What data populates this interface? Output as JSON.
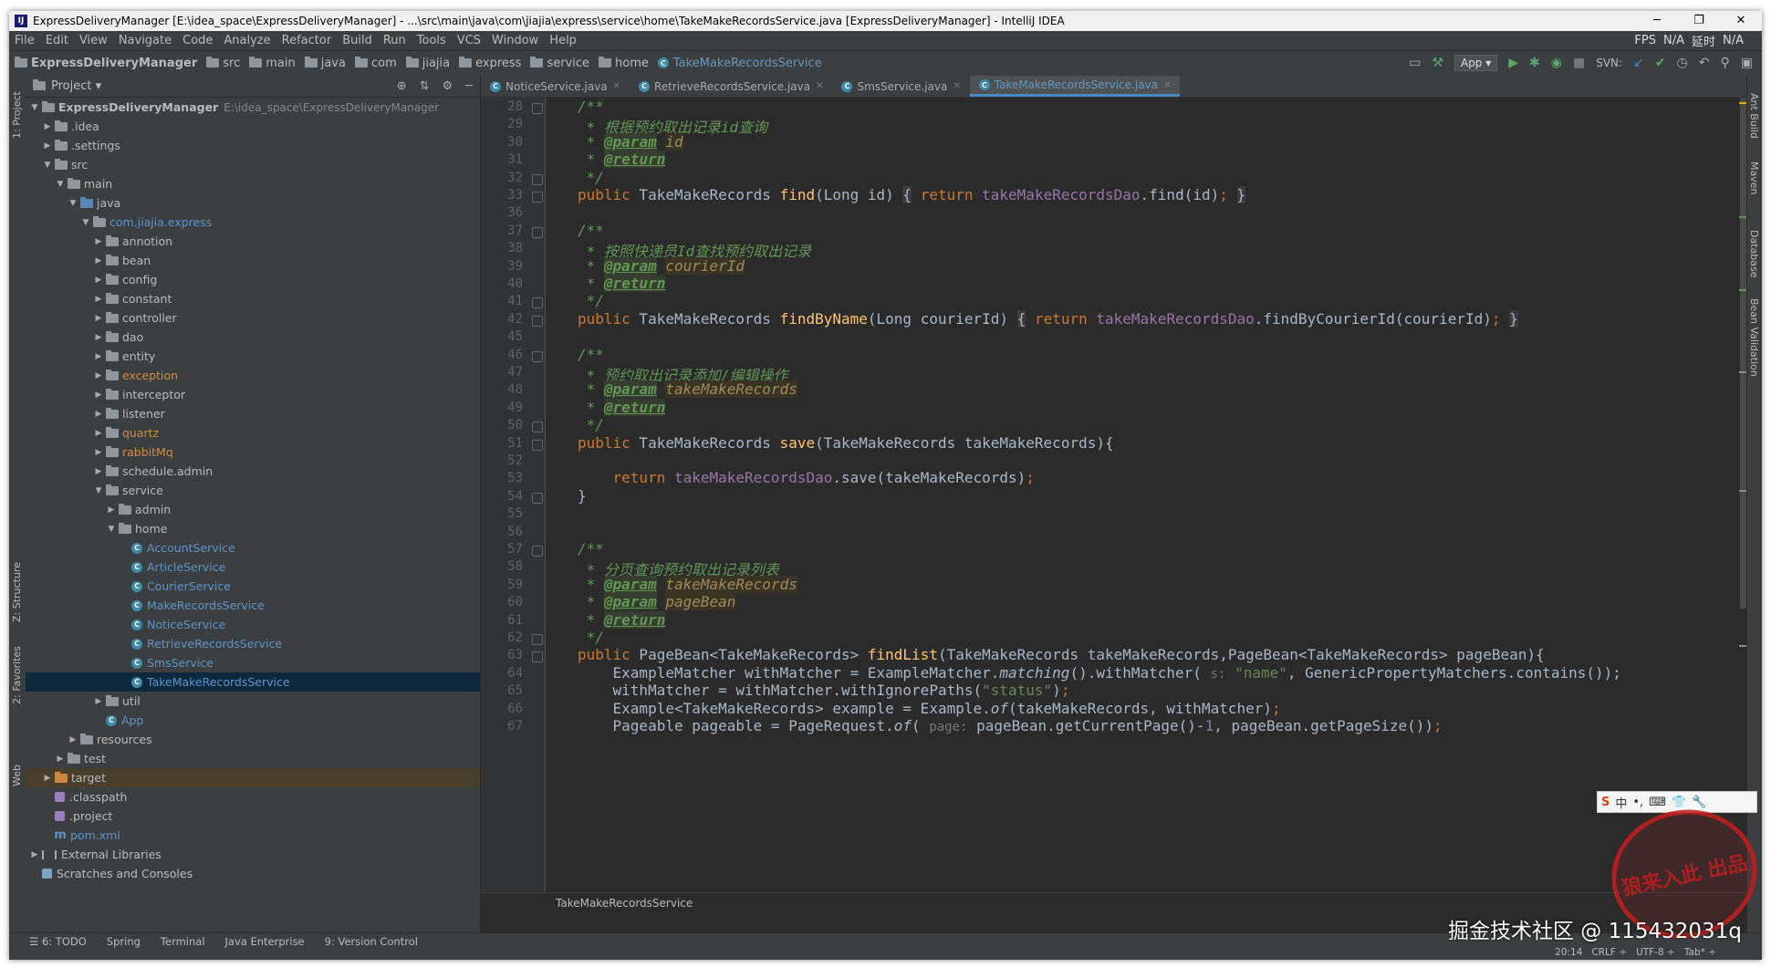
{
  "window": {
    "title": "ExpressDeliveryManager [E:\\idea_space\\ExpressDeliveryManager] - ...\\src\\main\\java\\com\\jiajia\\express\\service\\home\\TakeMakeRecordsService.java [ExpressDeliveryManager] - IntelliJ IDEA",
    "minimize": "─",
    "maximize": "❐",
    "close": "✕",
    "app_icon": "IJ"
  },
  "menu": {
    "items": [
      "File",
      "Edit",
      "View",
      "Navigate",
      "Code",
      "Analyze",
      "Refactor",
      "Build",
      "Run",
      "Tools",
      "VCS",
      "Window",
      "Help"
    ],
    "right": [
      "FPS",
      "N/A",
      "延时",
      "N/A"
    ]
  },
  "breadcrumb": [
    "ExpressDeliveryManager",
    "src",
    "main",
    "java",
    "com",
    "jiajia",
    "express",
    "service",
    "home",
    "TakeMakeRecordsService"
  ],
  "toolbar": {
    "run_config": "App ▾",
    "svn_label": "SVN:"
  },
  "left_strip": {
    "project": "1: Project",
    "structure": "Z: Structure",
    "favorites": "2: Favorites",
    "web": "Web"
  },
  "project_panel": {
    "title": "Project ▾"
  },
  "tree": [
    {
      "label": "ExpressDeliveryManager",
      "detail": "E:\\idea_space\\ExpressDeliveryManager",
      "depth": 0,
      "arrow": "▼",
      "kind": "folder",
      "bold": true
    },
    {
      "label": ".idea",
      "depth": 1,
      "arrow": "▶",
      "kind": "folder"
    },
    {
      "label": ".settings",
      "depth": 1,
      "arrow": "▶",
      "kind": "folder"
    },
    {
      "label": "src",
      "depth": 1,
      "arrow": "▼",
      "kind": "folder"
    },
    {
      "label": "main",
      "depth": 2,
      "arrow": "▼",
      "kind": "folder"
    },
    {
      "label": "java",
      "depth": 3,
      "arrow": "▼",
      "kind": "folder-blue"
    },
    {
      "label": "com.jiajia.express",
      "depth": 4,
      "arrow": "▼",
      "kind": "folder",
      "color": "blue"
    },
    {
      "label": "annotion",
      "depth": 5,
      "arrow": "▶",
      "kind": "folder"
    },
    {
      "label": "bean",
      "depth": 5,
      "arrow": "▶",
      "kind": "folder"
    },
    {
      "label": "config",
      "depth": 5,
      "arrow": "▶",
      "kind": "folder"
    },
    {
      "label": "constant",
      "depth": 5,
      "arrow": "▶",
      "kind": "folder"
    },
    {
      "label": "controller",
      "depth": 5,
      "arrow": "▶",
      "kind": "folder"
    },
    {
      "label": "dao",
      "depth": 5,
      "arrow": "▶",
      "kind": "folder"
    },
    {
      "label": "entity",
      "depth": 5,
      "arrow": "▶",
      "kind": "folder"
    },
    {
      "label": "exception",
      "depth": 5,
      "arrow": "▶",
      "kind": "folder",
      "color": "orange"
    },
    {
      "label": "interceptor",
      "depth": 5,
      "arrow": "▶",
      "kind": "folder"
    },
    {
      "label": "listener",
      "depth": 5,
      "arrow": "▶",
      "kind": "folder"
    },
    {
      "label": "quartz",
      "depth": 5,
      "arrow": "▶",
      "kind": "folder",
      "color": "orange"
    },
    {
      "label": "rabbitMq",
      "depth": 5,
      "arrow": "▶",
      "kind": "folder",
      "color": "orange"
    },
    {
      "label": "schedule.admin",
      "depth": 5,
      "arrow": "▶",
      "kind": "folder"
    },
    {
      "label": "service",
      "depth": 5,
      "arrow": "▼",
      "kind": "folder"
    },
    {
      "label": "admin",
      "depth": 6,
      "arrow": "▶",
      "kind": "folder"
    },
    {
      "label": "home",
      "depth": 6,
      "arrow": "▼",
      "kind": "folder"
    },
    {
      "label": "AccountService",
      "depth": 7,
      "arrow": "",
      "kind": "class",
      "color": "blue"
    },
    {
      "label": "ArticleService",
      "depth": 7,
      "arrow": "",
      "kind": "class",
      "color": "blue"
    },
    {
      "label": "CourierService",
      "depth": 7,
      "arrow": "",
      "kind": "class",
      "color": "blue"
    },
    {
      "label": "MakeRecordsService",
      "depth": 7,
      "arrow": "",
      "kind": "class",
      "color": "blue"
    },
    {
      "label": "NoticeService",
      "depth": 7,
      "arrow": "",
      "kind": "class",
      "color": "blue"
    },
    {
      "label": "RetrieveRecordsService",
      "depth": 7,
      "arrow": "",
      "kind": "class",
      "color": "blue"
    },
    {
      "label": "SmsService",
      "depth": 7,
      "arrow": "",
      "kind": "class",
      "color": "blue"
    },
    {
      "label": "TakeMakeRecordsService",
      "depth": 7,
      "arrow": "",
      "kind": "class",
      "color": "blue",
      "selected": true
    },
    {
      "label": "util",
      "depth": 5,
      "arrow": "▶",
      "kind": "folder"
    },
    {
      "label": "App",
      "depth": 5,
      "arrow": "",
      "kind": "class",
      "color": "blue"
    },
    {
      "label": "resources",
      "depth": 3,
      "arrow": "▶",
      "kind": "folder"
    },
    {
      "label": "test",
      "depth": 2,
      "arrow": "▶",
      "kind": "folder"
    },
    {
      "label": "target",
      "depth": 1,
      "arrow": "▶",
      "kind": "folder-orange",
      "highlight": true
    },
    {
      "label": ".classpath",
      "depth": 1,
      "arrow": "",
      "kind": "file"
    },
    {
      "label": ".project",
      "depth": 1,
      "arrow": "",
      "kind": "file"
    },
    {
      "label": "pom.xml",
      "depth": 1,
      "arrow": "",
      "kind": "maven",
      "color": "blue"
    },
    {
      "label": "External Libraries",
      "depth": 0,
      "arrow": "▶",
      "kind": "lib"
    },
    {
      "label": "Scratches and Consoles",
      "depth": 0,
      "arrow": "",
      "kind": "scratch"
    }
  ],
  "editor_tabs": [
    {
      "label": "NoticeService.java",
      "active": false
    },
    {
      "label": "RetrieveRecordsService.java",
      "active": false
    },
    {
      "label": "SmsService.java",
      "active": false
    },
    {
      "label": "TakeMakeRecordsService.java",
      "active": true
    }
  ],
  "code_lines": [
    {
      "n": "28",
      "html": "<span class=\"cm\">/**</span>"
    },
    {
      "n": "29",
      "html": "<span class=\"cm\"> * 根据预约取出记录id查询</span>"
    },
    {
      "n": "30",
      "html": "<span class=\"cm\"> * </span><span class=\"tag\">@param</span><span class=\"cm\"> </span><span class=\"pv\">id</span>"
    },
    {
      "n": "31",
      "html": "<span class=\"cm\"> * </span><span class=\"tag\">@return</span>"
    },
    {
      "n": "32",
      "html": "<span class=\"cm\"> */</span>"
    },
    {
      "n": "33",
      "html": "<span class=\"kw\">public</span> TakeMakeRecords <span class=\"fn\">find</span>(Long id) <span class=\"fold-brace\">{</span> <span class=\"kw\">return</span> <span class=\"fld\">takeMakeRecordsDao</span>.find(id)<span class=\"kw\">;</span> <span class=\"fold-brace\">}</span>"
    },
    {
      "n": "36",
      "html": ""
    },
    {
      "n": "37",
      "html": "<span class=\"cm\">/**</span>"
    },
    {
      "n": "38",
      "html": "<span class=\"cm\"> * 按照快递员Id查找预约取出记录</span>"
    },
    {
      "n": "39",
      "html": "<span class=\"cm\"> * </span><span class=\"tag\">@param</span><span class=\"cm\"> </span><span class=\"pv\">courierId</span>"
    },
    {
      "n": "40",
      "html": "<span class=\"cm\"> * </span><span class=\"tag\">@return</span>"
    },
    {
      "n": "41",
      "html": "<span class=\"cm\"> */</span>"
    },
    {
      "n": "42",
      "html": "<span class=\"kw\">public</span> TakeMakeRecords <span class=\"fn\">findByName</span>(Long courierId) <span class=\"fold-brace\">{</span> <span class=\"kw\">return</span> <span class=\"fld\">takeMakeRecordsDao</span>.findByCourierId(courierId)<span class=\"kw\">;</span> <span class=\"fold-brace\">}</span>"
    },
    {
      "n": "45",
      "html": ""
    },
    {
      "n": "46",
      "html": "<span class=\"cm\">/**</span>"
    },
    {
      "n": "47",
      "html": "<span class=\"cm\"> * 预约取出记录添加/编辑操作</span>"
    },
    {
      "n": "48",
      "html": "<span class=\"cm\"> * </span><span class=\"tag\">@param</span><span class=\"cm\"> </span><span class=\"pv\">takeMakeRecords</span>"
    },
    {
      "n": "49",
      "html": "<span class=\"cm\"> * </span><span class=\"tag\">@return</span>"
    },
    {
      "n": "50",
      "html": "<span class=\"cm\"> */</span>"
    },
    {
      "n": "51",
      "html": "<span class=\"kw\">public</span> TakeMakeRecords <span class=\"fn\">save</span>(TakeMakeRecords takeMakeRecords){"
    },
    {
      "n": "52",
      "html": ""
    },
    {
      "n": "53",
      "html": "    <span class=\"kw\">return</span> <span class=\"fld\">takeMakeRecordsDao</span>.save(takeMakeRecords)<span class=\"kw\">;</span>"
    },
    {
      "n": "54",
      "html": "}"
    },
    {
      "n": "55",
      "html": ""
    },
    {
      "n": "56",
      "html": ""
    },
    {
      "n": "57",
      "html": "<span class=\"cm\">/**</span>"
    },
    {
      "n": "58",
      "html": "<span class=\"cm\"> * 分页查询预约取出记录列表</span>"
    },
    {
      "n": "59",
      "html": "<span class=\"cm\"> * </span><span class=\"tag\">@param</span><span class=\"cm\"> </span><span class=\"pv\">takeMakeRecords</span>"
    },
    {
      "n": "60",
      "html": "<span class=\"cm\"> * </span><span class=\"tag\">@param</span><span class=\"cm\"> </span><span class=\"pv\">pageBean</span>"
    },
    {
      "n": "61",
      "html": "<span class=\"cm\"> * </span><span class=\"tag\">@return</span>"
    },
    {
      "n": "62",
      "html": "<span class=\"cm\"> */</span>"
    },
    {
      "n": "63",
      "html": "<span class=\"kw\">public</span> PageBean&lt;TakeMakeRecords&gt; <span class=\"fn\">findList</span>(TakeMakeRecords takeMakeRecords,PageBean&lt;TakeMakeRecords&gt; pageBean){"
    },
    {
      "n": "64",
      "html": "    ExampleMatcher withMatcher = ExampleMatcher.<span class=\"italic\">matching</span>().withMatcher( <span class=\"hint\">s:</span> <span class=\"str\">\"name\"</span>, GenericPropertyMatchers.contains());"
    },
    {
      "n": "65",
      "html": "    withMatcher = withMatcher.withIgnorePaths(<span class=\"str\">\"status\"</span>)<span class=\"kw\">;</span>"
    },
    {
      "n": "66",
      "html": "    Example&lt;TakeMakeRecords&gt; example = Example.<span class=\"italic\">of</span>(takeMakeRecords, withMatcher)<span class=\"kw\">;</span>"
    },
    {
      "n": "67",
      "html": "    Pageable pageable = PageRequest.<span class=\"italic\">of</span>( <span class=\"hint\">page:</span> pageBean.getCurrentPage()-<span class=\"fld\">1</span>, pageBean.getPageSize())<span class=\"kw\">;</span>"
    }
  ],
  "editor_breadcrumb": "TakeMakeRecordsService",
  "right_strip": [
    "Ant Build",
    "Maven",
    "Database",
    "Bean Validation"
  ],
  "bottom_tools": [
    "☰ 6: TODO",
    "Spring",
    "Terminal",
    "Java Enterprise",
    "9: Version Control"
  ],
  "status": {
    "position": "20:14",
    "line_sep": "CRLF ÷",
    "encoding": "UTF-8 ÷",
    "indent": "Tab* ÷"
  },
  "ime": {
    "logo": "S",
    "mode": "中"
  },
  "stamp_text": "狼来入此 出品",
  "watermark": "掘金技术社区 @ 115432031q",
  "colors": {
    "bg": "#2b2b2b",
    "panel": "#3c3f41",
    "keyword": "#cc7832",
    "comment": "#629755",
    "function": "#ffc66d",
    "field": "#9876aa",
    "string": "#6a8759",
    "selection": "#0d293e"
  }
}
